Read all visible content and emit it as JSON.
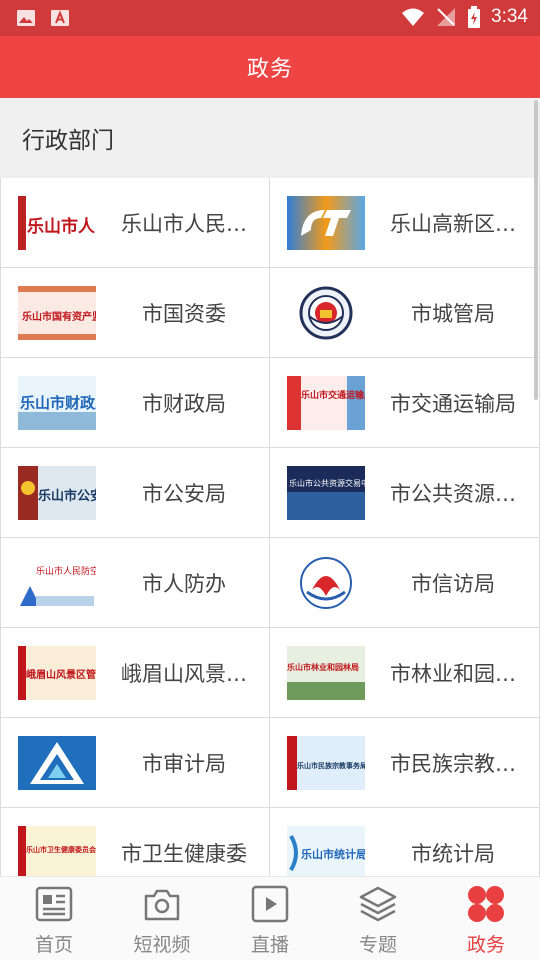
{
  "status_bar": {
    "time": "3:34"
  },
  "app_bar": {
    "title": "政务"
  },
  "section": {
    "title": "行政部门"
  },
  "departments": [
    {
      "name": "乐山市人民…",
      "logo_text": "乐山市人民政"
    },
    {
      "name": "乐山高新区…",
      "logo_text": ""
    },
    {
      "name": "市国资委",
      "logo_text": "乐山市国有资产监督管理委员"
    },
    {
      "name": "市城管局",
      "logo_text": ""
    },
    {
      "name": "市财政局",
      "logo_text": "乐山市财政局"
    },
    {
      "name": "市交通运输局",
      "logo_text": "乐山市交通运输局"
    },
    {
      "name": "市公安局",
      "logo_text": "乐山市公安局"
    },
    {
      "name": "市公共资源…",
      "logo_text": "乐山市公共资源交易中心"
    },
    {
      "name": "市人防办",
      "logo_text": "乐山市人民防空办"
    },
    {
      "name": "市信访局",
      "logo_text": ""
    },
    {
      "name": "峨眉山风景…",
      "logo_text": "峨眉山风景区管委"
    },
    {
      "name": "市林业和园…",
      "logo_text": "乐山市林业和园林局"
    },
    {
      "name": "市审计局",
      "logo_text": ""
    },
    {
      "name": "市民族宗教…",
      "logo_text": "乐山市民族宗教事务局"
    },
    {
      "name": "市卫生健康委",
      "logo_text": "乐山市卫生健康委员会"
    },
    {
      "name": "市统计局",
      "logo_text": "乐山市统计局"
    }
  ],
  "bottom_nav": [
    {
      "label": "首页",
      "icon": "newspaper-icon",
      "active": false
    },
    {
      "label": "短视频",
      "icon": "camera-icon",
      "active": false
    },
    {
      "label": "直播",
      "icon": "play-icon",
      "active": false
    },
    {
      "label": "专题",
      "icon": "layers-icon",
      "active": false
    },
    {
      "label": "政务",
      "icon": "petals-icon",
      "active": true
    }
  ],
  "colors": {
    "brand_red": "#ee4444",
    "status_red": "#d03a3a",
    "active_nav": "#e84040",
    "inactive_nav": "#888888"
  }
}
